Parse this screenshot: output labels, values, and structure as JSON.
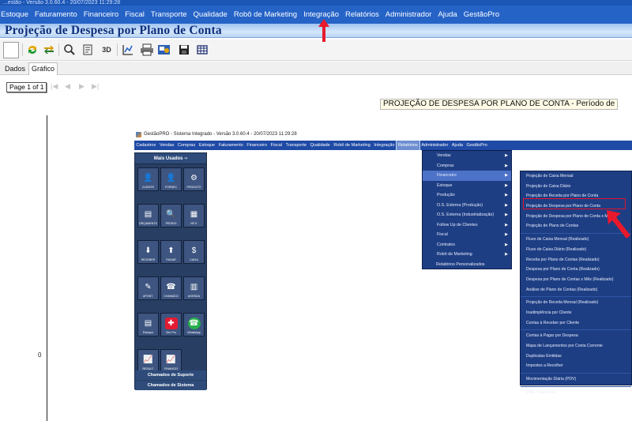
{
  "top_strip": {
    "text": "...estão - Versão 3.0.60.4 - 20/07/2023 11:29:28"
  },
  "menu": {
    "items": [
      "Estoque",
      "Faturamento",
      "Financeiro",
      "Fiscal",
      "Transporte",
      "Qualidade",
      "Robô de Marketing",
      "Integração",
      "Relatórios",
      "Administrador",
      "Ajuda",
      "GestãoPro"
    ]
  },
  "window_title": "Projeção de Despesa por Plano de Conta",
  "toolbar": {
    "icons": [
      "blank-box-icon",
      "refresh-icon",
      "transfer-icon",
      "zoom-icon",
      "page-icon",
      "3d-icon",
      "chart-line-icon",
      "print-icon",
      "export-icon",
      "save-icon",
      "grid-icon"
    ],
    "three_d_label": "3D"
  },
  "tabs": [
    {
      "label": "Dados",
      "active": false
    },
    {
      "label": "Gráfico",
      "active": true
    }
  ],
  "report": {
    "pager": "Page 1 of 1",
    "nav_glyphs": [
      "|◀",
      "◀",
      "▶",
      "▶|"
    ],
    "title": "PROJEÇÃO DE DESPESA POR PLANO DE CONTA - Período de",
    "axis_zero": "0"
  },
  "inner": {
    "title": "GestãoPRO - Sistema Integrado - Versão 3.0.60.4 - 20/07/2023 11:29:28",
    "menu": [
      "Cadastros",
      "Vendas",
      "Compras",
      "Estoque",
      "Faturamento",
      "Financeiro",
      "Fiscal",
      "Transporte",
      "Qualidade",
      "Robô de Marketing",
      "Integração",
      "Relatórios",
      "Administrador",
      "Ajuda",
      "GestãoPro"
    ],
    "selected_menu": "Relatórios",
    "panel_title": "Mais Usados -›",
    "buttons": [
      [
        "CLIENTE",
        "FORNEC",
        "PRODUTO"
      ],
      [
        "ORÇAMENTO",
        "PEDIDO",
        "NF-E"
      ],
      [
        "RECEBER",
        "PAGAR",
        "CAIXA"
      ],
      [
        "APONT.",
        "CHAMADO",
        "AGENDA"
      ],
      [
        "Estoque",
        "Zen Pro",
        "WhatsApp"
      ],
      [
        "RESULT",
        "FINANCEI"
      ]
    ],
    "panel_footer": [
      "Chamados de Suporte",
      "Chamados de Sistema"
    ],
    "dropdown1": [
      "Vendas",
      "Compras",
      "Financeiro",
      "Estoque",
      "Produção",
      "O.S. Externa (Produção)",
      "O.S. Externa (Industrialização)",
      "Follow Up de Clientes",
      "Fiscal",
      "Contratos",
      "Robô de Marketing",
      "Relatórios Personalizados"
    ],
    "dropdown1_selected": "Financeiro",
    "dropdown2_groups": [
      [
        "Projeção de Caixa Mensal",
        "Projeção de Caixa Diário",
        "Projeção de Receita por Plano de Conta",
        "Projeção de Despesa por Plano de Conta",
        "Projeção de Despesa por Plano de Conta x Mês",
        "Projeção de Plano de Contas"
      ],
      [
        "Fluxo de Caixa Mensal (Realizado)",
        "Fluxo de Caixa Diário (Realizado)",
        "Receita por Plano de Contas (Realizado)",
        "Despesa por Plano de Conta (Realizado)",
        "Despesa por Plano de Contas x Mês (Realizado)",
        "Análise de Plano de Contas (Realizado)"
      ],
      [
        "Projeção de Receita Mensal (Realizado)",
        "Inadimplência por Cliente",
        "Contas à Receber por Cliente"
      ],
      [
        "Contas à Pagar por Despesa",
        "Mapa de Lançamentos por Conta Corrente",
        "Duplicatas Emitidas",
        "Impostos a Recolher"
      ],
      [
        "Movimentação Diária (PDV)"
      ],
      [
        "DRE - Gerencial"
      ]
    ]
  },
  "colors": {
    "menubar": "#2563c7",
    "title_text": "#0d2f7a",
    "inner_menu": "#1f4aa5",
    "dropdown_bg": "#1e3e84",
    "highlight": "#e0142b"
  }
}
